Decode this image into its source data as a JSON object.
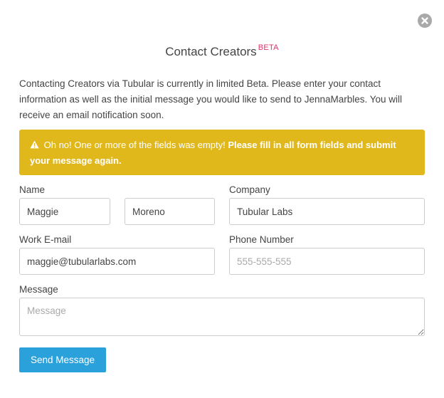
{
  "modal": {
    "title": "Contact Creators",
    "beta_badge": "BETA",
    "intro": "Contacting Creators via Tubular is currently in limited Beta. Please enter your contact information as well as the initial message you would like to send to JennaMarbles. You will receive an email notification soon."
  },
  "alert": {
    "icon": "warning-icon",
    "message": "Oh no! One or more of the fields was empty!",
    "emphasis": "Please fill in all form fields and submit your message again.",
    "background_color": "#e1b81c"
  },
  "form": {
    "name_label": "Name",
    "first_name_value": "Maggie",
    "last_name_value": "Moreno",
    "company_label": "Company",
    "company_value": "Tubular Labs",
    "email_label": "Work E-mail",
    "email_value": "maggie@tubularlabs.com",
    "phone_label": "Phone Number",
    "phone_placeholder": "555-555-555",
    "message_label": "Message",
    "message_placeholder": "Message",
    "submit_label": "Send Message",
    "submit_color": "#2ba1dc"
  },
  "icons": {
    "close": "close-circle-icon"
  }
}
